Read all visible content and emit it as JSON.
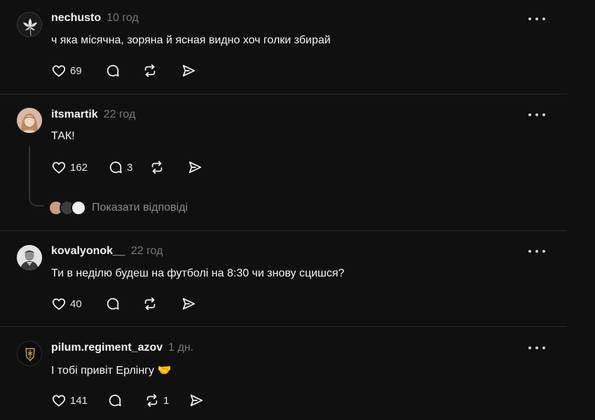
{
  "posts": [
    {
      "username": "nechusto",
      "time": "10 год",
      "text": "ч яка місячна, зоряна й ясная видно хоч голки збирай",
      "likes": "69",
      "comments": "",
      "reposts": "",
      "avatar_icon": "lily-flower-avatar"
    },
    {
      "username": "itsmartik",
      "time": "22 год",
      "text": "ТАК!",
      "likes": "162",
      "comments": "3",
      "reposts": "",
      "avatar_icon": "girl-portrait-avatar",
      "show_replies": "Показати відповіді"
    },
    {
      "username": "kovalyonok__",
      "time": "22 год",
      "text": "Ти в неділю будеш на футболі на 8:30 чи знову сцишся?",
      "likes": "40",
      "comments": "",
      "reposts": "",
      "avatar_icon": "man-portrait-avatar"
    },
    {
      "username": "pilum.regiment_azov",
      "time": "1 дн.",
      "text": "І тобі привіт Ерлінгу",
      "emoji": "🤝",
      "likes": "141",
      "comments": "",
      "reposts": "1",
      "avatar_icon": "azov-emblem-avatar"
    }
  ],
  "icons": [
    "heart-icon",
    "comment-icon",
    "repost-icon",
    "share-icon",
    "more-icon"
  ],
  "colors": {
    "background": "#101010",
    "divider": "#2a2a2a",
    "text": "#f3f5f7",
    "muted": "#777777",
    "emoji_yellow": "#f4c430"
  }
}
